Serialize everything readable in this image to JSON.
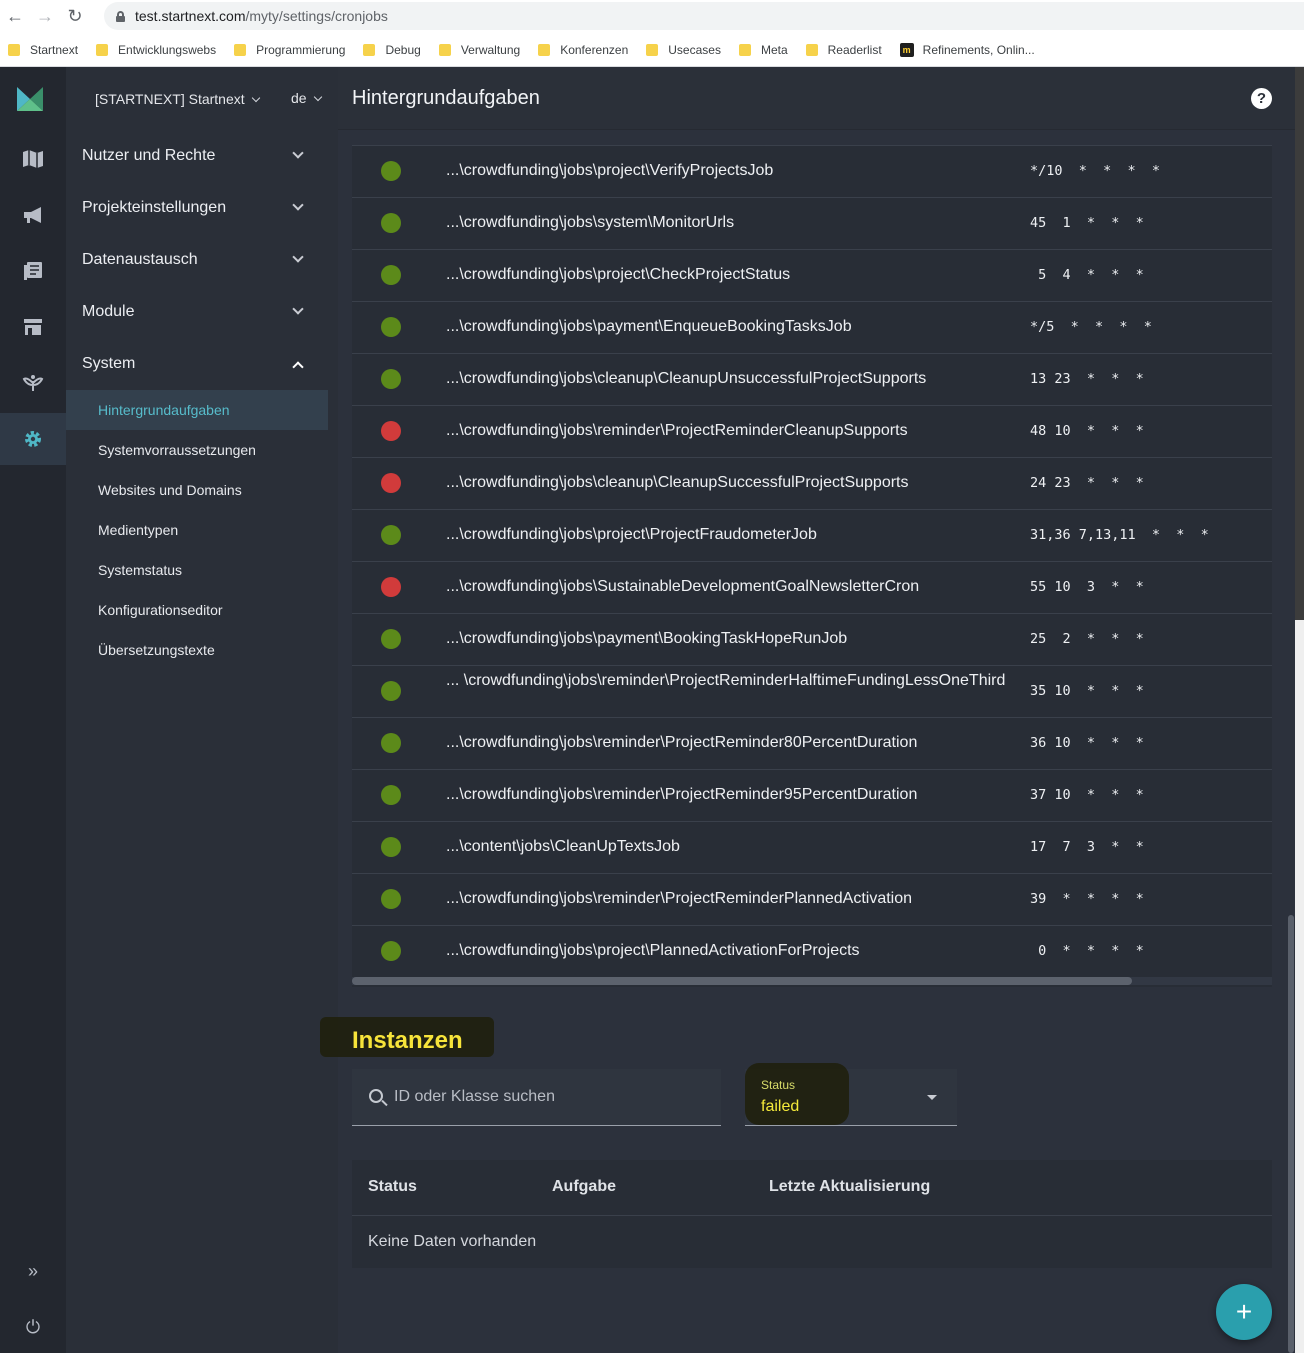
{
  "browser": {
    "url_host": "test.startnext.com",
    "url_path": "/myty/settings/cronjobs",
    "bookmarks": [
      {
        "label": "Startnext"
      },
      {
        "label": "Entwicklungswebs"
      },
      {
        "label": "Programmierung"
      },
      {
        "label": "Debug"
      },
      {
        "label": "Verwaltung"
      },
      {
        "label": "Konferenzen"
      },
      {
        "label": "Usecases"
      },
      {
        "label": "Meta"
      },
      {
        "label": "Readerlist"
      },
      {
        "label": "Refinements, Onlin..."
      }
    ]
  },
  "sidebar": {
    "workspace": "[STARTNEXT] Startnext",
    "language": "de",
    "sections": [
      {
        "label": "Nutzer und Rechte"
      },
      {
        "label": "Projekteinstellungen"
      },
      {
        "label": "Datenaustausch"
      },
      {
        "label": "Module"
      },
      {
        "label": "System"
      }
    ],
    "system_items": [
      {
        "label": "Hintergrundaufgaben"
      },
      {
        "label": "Systemvorraussetzungen"
      },
      {
        "label": "Websites und Domains"
      },
      {
        "label": "Medientypen"
      },
      {
        "label": "Systemstatus"
      },
      {
        "label": "Konfigurationseditor"
      },
      {
        "label": "Übersetzungstexte"
      }
    ]
  },
  "header": {
    "title": "Hintergrundaufgaben",
    "help_icon": "?"
  },
  "jobs": [
    {
      "status": "ok",
      "class": "...\\crowdfunding\\jobs\\project\\VerifyProjectsJob",
      "cron": "*/10  *  *  *  *"
    },
    {
      "status": "ok",
      "class": "...\\crowdfunding\\jobs\\system\\MonitorUrls",
      "cron": "45  1  *  *  *"
    },
    {
      "status": "ok",
      "class": "...\\crowdfunding\\jobs\\project\\CheckProjectStatus",
      "cron": " 5  4  *  *  *"
    },
    {
      "status": "ok",
      "class": "...\\crowdfunding\\jobs\\payment\\EnqueueBookingTasksJob",
      "cron": "*/5  *  *  *  *"
    },
    {
      "status": "ok",
      "class": "...\\crowdfunding\\jobs\\cleanup\\CleanupUnsuccessfulProjectSupports",
      "cron": "13 23  *  *  *"
    },
    {
      "status": "fail",
      "class": "...\\crowdfunding\\jobs\\reminder\\ProjectReminderCleanupSupports",
      "cron": "48 10  *  *  *"
    },
    {
      "status": "fail",
      "class": "...\\crowdfunding\\jobs\\cleanup\\CleanupSuccessfulProjectSupports",
      "cron": "24 23  *  *  *"
    },
    {
      "status": "ok",
      "class": "...\\crowdfunding\\jobs\\project\\ProjectFraudometerJob",
      "cron": "31,36 7,13,11  *  *  *"
    },
    {
      "status": "fail",
      "class": "...\\crowdfunding\\jobs\\SustainableDevelopmentGoalNewsletterCron",
      "cron": "55 10  3  *  *"
    },
    {
      "status": "ok",
      "class": "...\\crowdfunding\\jobs\\payment\\BookingTaskHopeRunJob",
      "cron": "25  2  *  *  *"
    },
    {
      "status": "ok",
      "class": "... \\crowdfunding\\jobs\\reminder\\ProjectReminderHalftimeFundingLessOneThird",
      "cron": "35 10  *  *  *"
    },
    {
      "status": "ok",
      "class": "...\\crowdfunding\\jobs\\reminder\\ProjectReminder80PercentDuration",
      "cron": "36 10  *  *  *"
    },
    {
      "status": "ok",
      "class": "...\\crowdfunding\\jobs\\reminder\\ProjectReminder95PercentDuration",
      "cron": "37 10  *  *  *"
    },
    {
      "status": "ok",
      "class": "...\\content\\jobs\\CleanUpTextsJob",
      "cron": "17  7  3  *  *"
    },
    {
      "status": "ok",
      "class": "...\\crowdfunding\\jobs\\reminder\\ProjectReminderPlannedActivation",
      "cron": "39  *  *  *  *"
    },
    {
      "status": "ok",
      "class": "...\\crowdfunding\\jobs\\project\\PlannedActivationForProjects",
      "cron": " 0  *  *  *  *"
    }
  ],
  "instances": {
    "title": "Instanzen",
    "search_placeholder": "ID oder Klasse suchen",
    "status_label": "Status",
    "status_value": "failed",
    "columns": [
      "Status",
      "Aufgabe",
      "Letzte Aktualisierung"
    ],
    "empty_text": "Keine Daten vorhanden"
  },
  "fab_label": "+",
  "colors": {
    "ok": "#5c8a1a",
    "fail": "#d13b3b",
    "accent": "#2a9fad",
    "highlight_text": "#f7e43a"
  }
}
